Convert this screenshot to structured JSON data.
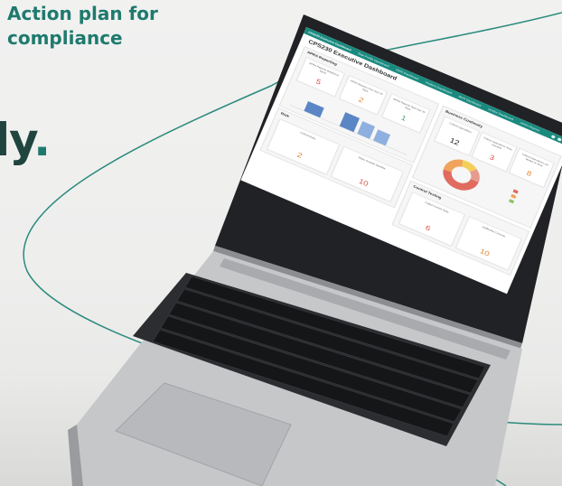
{
  "headline": "Action plan for\ncompliance",
  "left_word": "ly",
  "left_word_dot": ".",
  "colors": {
    "brand_teal": "#1f7a6e",
    "header_teal": "#1a8a7f",
    "value_red": "#d9564b",
    "value_orange": "#e28733",
    "value_green": "#3ea86a"
  },
  "dashboard": {
    "title": "CPS230 Executive Dashboard",
    "tabs": [
      "CPS230 Executive Dashboard",
      "Risk Profile Dashboard",
      "OMS Dashboard",
      "Incident Dashboard",
      "BCM Dashboard",
      "Vendor Dashboard",
      "APRA Reports"
    ],
    "apra": {
      "title": "APRA Reporting",
      "cards": [
        {
          "label": "APRA Reports Waiting to Send",
          "value": "5"
        },
        {
          "label": "APRA Reports Due next 30 days",
          "value": "2"
        },
        {
          "label": "APRA Reports Sent last 30 days",
          "value": "1"
        }
      ]
    },
    "business_continuity": {
      "title": "Business Continuity",
      "cards": [
        {
          "label": "Critical Operations",
          "value": "12"
        },
        {
          "label": "Critical Operations Tests overdue",
          "value": "3"
        },
        {
          "label": "Critical Operations not Tested on time",
          "value": "8"
        }
      ]
    },
    "risk": {
      "title": "Risk",
      "cards": [
        {
          "label": "Critical Risks",
          "value": "2"
        },
        {
          "label": "Risks Outside Appetite",
          "value": "10"
        }
      ]
    },
    "control_testing": {
      "title": "Control Testing",
      "cards": [
        {
          "label": "Failed Control Tests",
          "value": "6"
        },
        {
          "label": "Ineffective Controls",
          "value": "10"
        }
      ]
    }
  }
}
